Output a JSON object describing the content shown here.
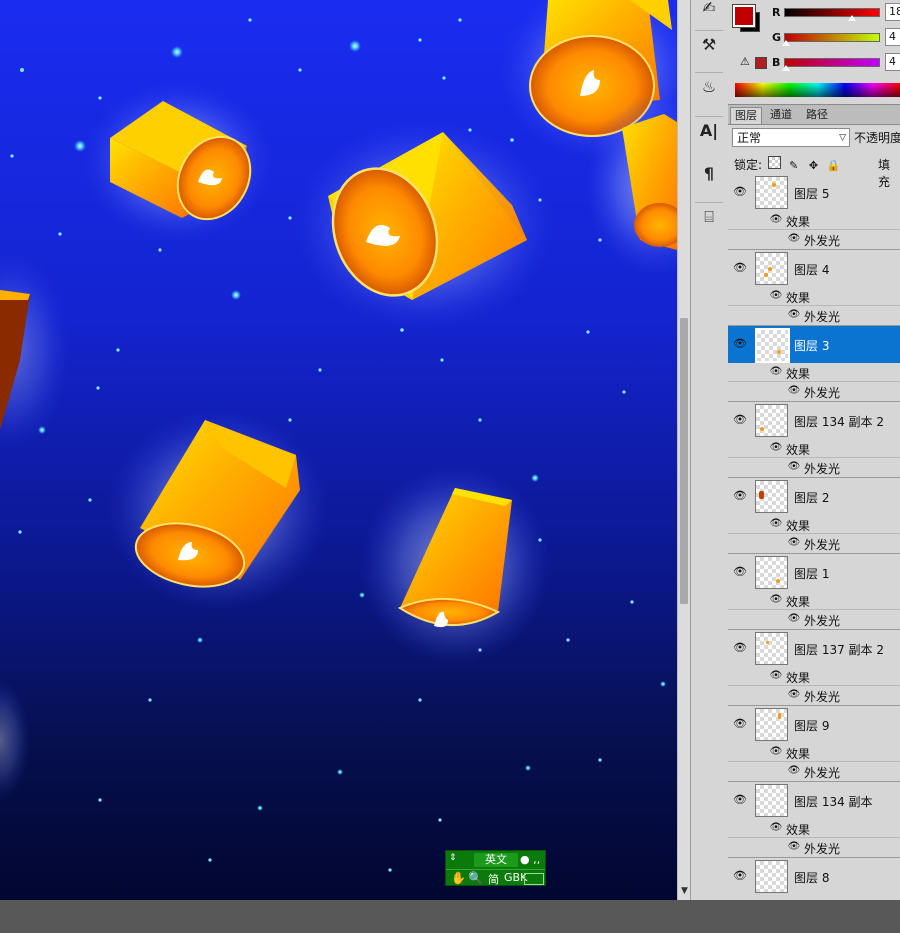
{
  "canvas": {
    "description_none": ""
  },
  "color_panel": {
    "fg_color": "#c00000",
    "bg_color": "#000000",
    "sliders": [
      {
        "label": "R",
        "value": "18",
        "fill": "linear-gradient(90deg,#000000,#ff0000)",
        "fraction": 0.72
      },
      {
        "label": "G",
        "value": "4",
        "fill": "linear-gradient(90deg,#c00000,#c0ff00)",
        "fraction": 0.02
      },
      {
        "label": "B",
        "value": "4",
        "fill": "linear-gradient(90deg,#c00000,#c000ff)",
        "fraction": 0.02
      }
    ]
  },
  "layers_panel": {
    "tabs": [
      "图层",
      "通道",
      "路径"
    ],
    "blend_mode": "正常",
    "opacity_label": "不透明度",
    "lock_label": "锁定:",
    "fill_label": "填充",
    "effects_label": "效果",
    "glow_label": "外发光",
    "selected_index": 2,
    "layers": [
      {
        "name": "图层 5"
      },
      {
        "name": "图层 4"
      },
      {
        "name": "图层 3"
      },
      {
        "name": "图层 134 副本 2"
      },
      {
        "name": "图层 2"
      },
      {
        "name": "图层 1"
      },
      {
        "name": "图层 137 副本 2"
      },
      {
        "name": "图层 9"
      },
      {
        "name": "图层 134 副本"
      },
      {
        "name": "图层 8"
      }
    ]
  },
  "ime": {
    "lang": "英文",
    "simp": "简",
    "enc": "GBK"
  },
  "icons": {
    "eye": "eye-icon",
    "hand": "hand-icon",
    "search": "magnifier-icon"
  }
}
